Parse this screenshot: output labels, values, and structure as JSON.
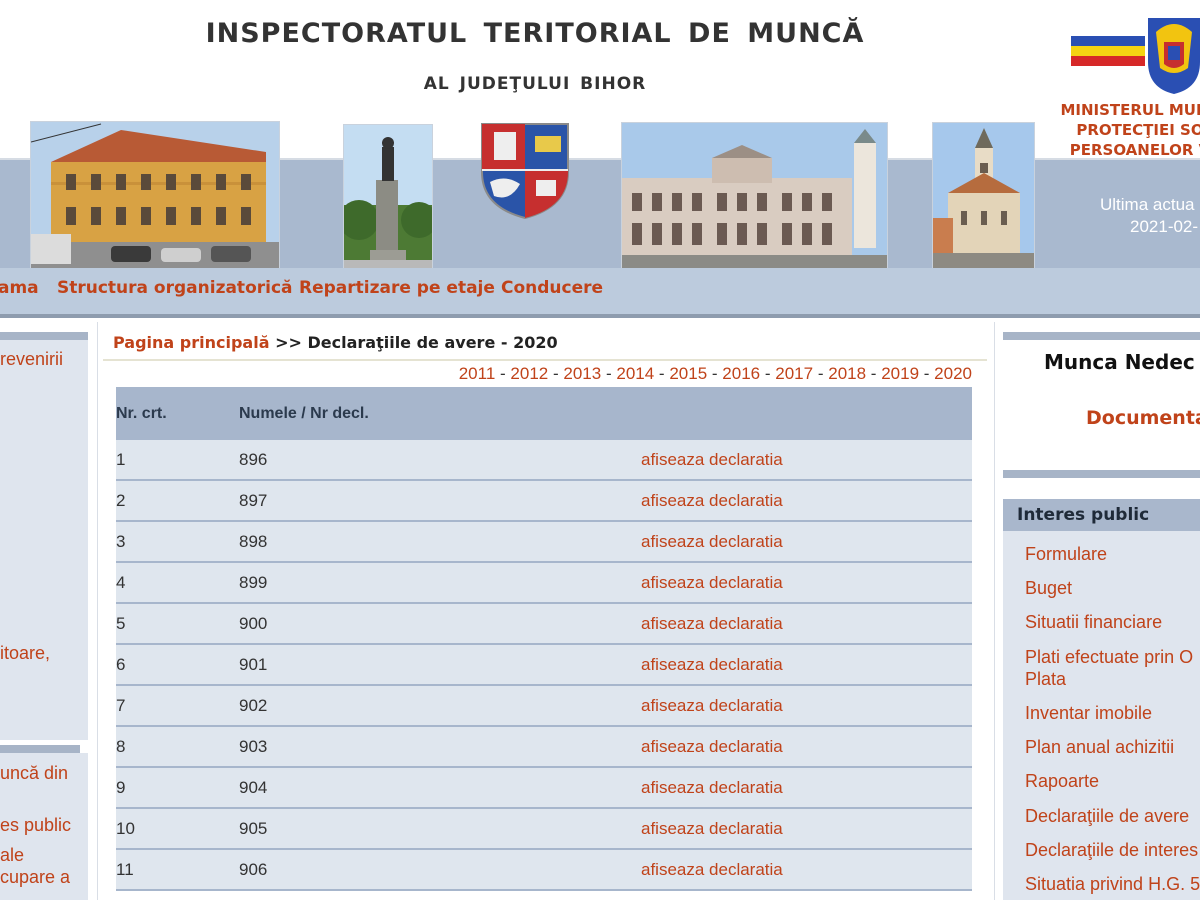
{
  "header": {
    "title": "INSPECTORATUL TERITORIAL DE MUNCĂ",
    "subtitle": "AL JUDEŢULUI BIHOR",
    "ministry_lines": [
      "MINISTERUL MUNC",
      "PROTECŢIEI SO",
      "PERSOANELOR V"
    ],
    "last_update_label": "Ultima actua",
    "last_update_date": "2021-02-"
  },
  "nav": {
    "items": [
      "ama",
      "Structura organizatorică",
      "Repartizare pe etaje",
      "Conducere"
    ]
  },
  "left_sidebar": {
    "texts": [
      "revenirii",
      "itoare,",
      "uncă din",
      "es public",
      "ale",
      "cupare a"
    ]
  },
  "breadcrumb": {
    "home": "Pagina principală",
    "separator": ">>",
    "current": "Declaraţiile de avere - 2020"
  },
  "years": {
    "items": [
      "2011",
      "2012",
      "2013",
      "2014",
      "2015",
      "2016",
      "2017",
      "2018",
      "2019",
      "2020"
    ],
    "separator": "-"
  },
  "table": {
    "headers": [
      "Nr. crt.",
      "Numele / Nr decl.",
      ""
    ],
    "rows": [
      {
        "nr": "1",
        "decl": "896",
        "link": "afiseaza declaratia"
      },
      {
        "nr": "2",
        "decl": "897",
        "link": "afiseaza declaratia"
      },
      {
        "nr": "3",
        "decl": "898",
        "link": "afiseaza declaratia"
      },
      {
        "nr": "4",
        "decl": "899",
        "link": "afiseaza declaratia"
      },
      {
        "nr": "5",
        "decl": "900",
        "link": "afiseaza declaratia"
      },
      {
        "nr": "6",
        "decl": "901",
        "link": "afiseaza declaratia"
      },
      {
        "nr": "7",
        "decl": "902",
        "link": "afiseaza declaratia"
      },
      {
        "nr": "8",
        "decl": "903",
        "link": "afiseaza declaratia"
      },
      {
        "nr": "9",
        "decl": "904",
        "link": "afiseaza declaratia"
      },
      {
        "nr": "10",
        "decl": "905",
        "link": "afiseaza declaratia"
      },
      {
        "nr": "11",
        "decl": "906",
        "link": "afiseaza declaratia"
      }
    ]
  },
  "right_sidebar": {
    "promo_title": "Munca Nedec",
    "promo_link": "Documenta",
    "section_title": "Interes public",
    "items": [
      "Formulare",
      "Buget",
      "Situatii financiare",
      "Plati efectuate prin O",
      "Plata",
      "Inventar imobile",
      "Plan anual achizitii",
      "Rapoarte",
      "Declaraţiile de avere",
      "Declaraţiile de interes",
      "Situatia privind H.G. 5"
    ]
  },
  "colors": {
    "link": "#c0431a",
    "band": "#a9b9cf",
    "nav": "#bccbdd",
    "table_header": "#a7b6cc",
    "table_row": "#dfe6ee",
    "flag_blue": "#2a4fb3",
    "flag_yellow": "#f5d313",
    "flag_red": "#d62828"
  }
}
